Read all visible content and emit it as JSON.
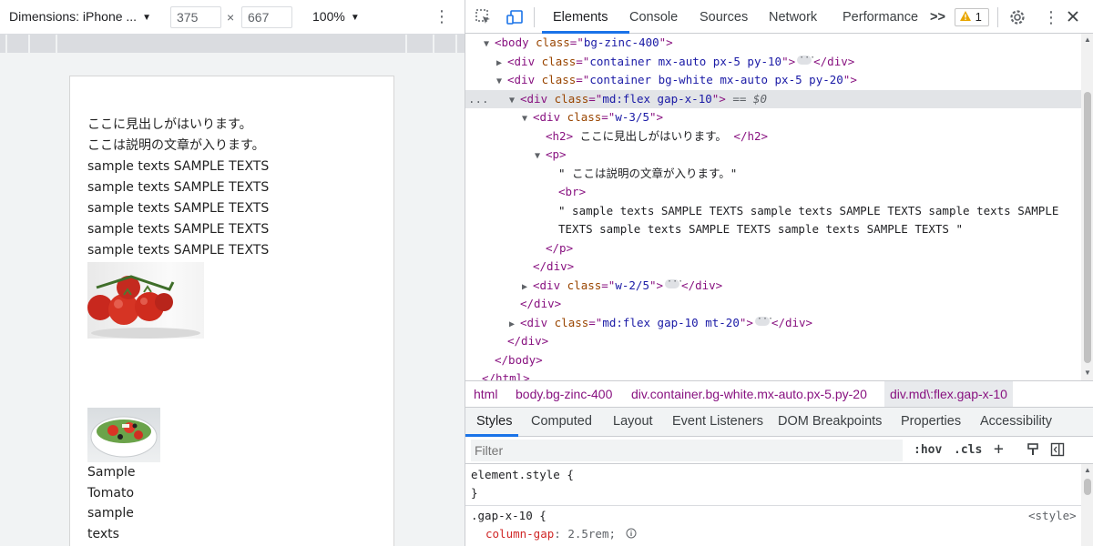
{
  "device_toolbar": {
    "dimensions_label": "Dimensions: iPhone ...",
    "width": "375",
    "height": "667",
    "times": "×",
    "zoom": "100%"
  },
  "phone": {
    "heading": "ここに見出しがはいります。",
    "description": "ここは説明の文章が入ります。",
    "sample_lines": [
      "sample texts SAMPLE TEXTS",
      "sample texts SAMPLE TEXTS",
      "sample texts SAMPLE TEXTS",
      "sample texts SAMPLE TEXTS",
      "sample texts SAMPLE TEXTS"
    ],
    "second_block_lines": [
      "Sample",
      "Tomato",
      "sample",
      "texts"
    ]
  },
  "devtools": {
    "tabs": [
      "Elements",
      "Console",
      "Sources",
      "Network",
      "Performance"
    ],
    "more_tabs": ">>",
    "warning_count": "1",
    "dom": {
      "l_body_open": [
        "<body ",
        "class",
        "=\"",
        "bg-zinc-400",
        "\">"
      ],
      "l_container1": [
        "<div ",
        "class",
        "=\"",
        "container mx-auto px-5 py-10",
        "\">",
        "</div>"
      ],
      "l_container2": [
        "<div ",
        "class",
        "=\"",
        "container bg-white mx-auto px-5 py-20",
        "\">"
      ],
      "l_flex": [
        "<div ",
        "class",
        "=\"",
        "md:flex gap-x-10",
        "\">",
        " == $0"
      ],
      "l_w35": [
        "<div ",
        "class",
        "=\"",
        "w-3/5",
        "\">"
      ],
      "l_h2": [
        "<h2>",
        " ここに見出しがはいります。 ",
        "</h2>"
      ],
      "l_p_open": "<p>",
      "l_text1": "\" ここは説明の文章が入ります。\"",
      "l_br": "<br>",
      "l_text2a": "\" sample texts SAMPLE TEXTS sample texts SAMPLE TEXTS sample texts SAMPLE",
      "l_text2b": "TEXTS sample texts SAMPLE TEXTS sample texts SAMPLE TEXTS \"",
      "l_p_close": "</p>",
      "l_div_close1": "</div>",
      "l_w25": [
        "<div ",
        "class",
        "=\"",
        "w-2/5",
        "\">",
        "</div>"
      ],
      "l_div_close2": "</div>",
      "l_flex2": [
        "<div ",
        "class",
        "=\"",
        "md:flex gap-10 mt-20",
        "\">",
        "</div>"
      ],
      "l_div_close3": "</div>",
      "l_body_close": "</body>",
      "l_html_close": "</html>",
      "gutter_dots": "..."
    },
    "breadcrumbs": [
      "html",
      "body.bg-zinc-400",
      "div.container.bg-white.mx-auto.px-5.py-20",
      "div.md\\:flex.gap-x-10"
    ],
    "style_tabs": [
      "Styles",
      "Computed",
      "Layout",
      "Event Listeners",
      "DOM Breakpoints",
      "Properties",
      "Accessibility"
    ],
    "filter_placeholder": "Filter",
    "filter_tools": [
      ":hov",
      ".cls"
    ],
    "styles": {
      "element_style_open": "element.style {",
      "element_style_close": "}",
      "rule_selector": ".gap-x-10 {",
      "rule_source": "<style>",
      "prop_name": "column-gap",
      "prop_value": "2.5rem;"
    }
  },
  "colors": {
    "accent": "#1a73e8",
    "tag": "#881280",
    "attr_name": "#994500",
    "attr_value": "#1a1aa6",
    "warning": "#e8a600"
  }
}
